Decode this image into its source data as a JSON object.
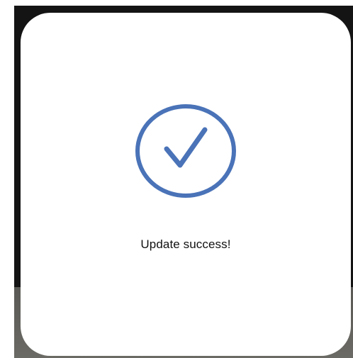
{
  "dialog": {
    "icon": "check-circle-icon",
    "message": "Update success!"
  },
  "colors": {
    "accent": "#4a73b8",
    "backdrop": "#141414",
    "surface": "#ffffff"
  }
}
